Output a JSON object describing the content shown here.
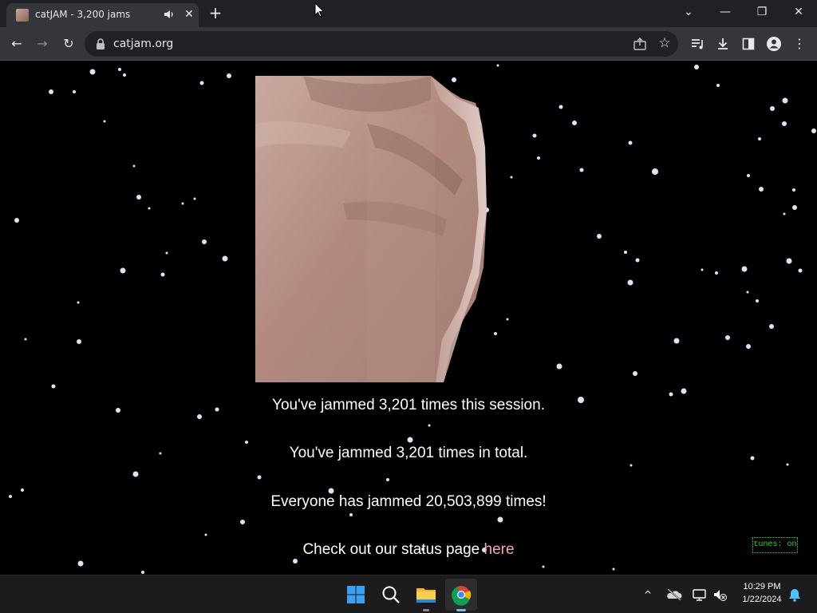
{
  "browser": {
    "tab": {
      "title": "catJAM - 3,200 jams",
      "audio_icon": "speaker-icon",
      "close_label": "✕"
    },
    "new_tab_label": "+",
    "window": {
      "tab_search_label": "⌄",
      "minimize_label": "—",
      "restore_label": "❐",
      "close_label": "✕"
    },
    "toolbar": {
      "back_label": "←",
      "forward_label": "→",
      "reload_label": "↻",
      "url": "catjam.org",
      "star_label": "☆",
      "menu_label": "⋮"
    }
  },
  "page": {
    "session_text": "You've jammed 3,201 times this session.",
    "total_text": "You've jammed 3,201 times in total.",
    "everyone_text": "Everyone has jammed 20,503,899 times!",
    "status_text": "Check out our status page ",
    "status_link_text": "here",
    "tunes_toggle": "tunes: on"
  },
  "taskbar": {
    "tray_chevron_label": "^",
    "time": "10:29 PM",
    "date": "1/22/2024",
    "icons": [
      "windows-start-icon",
      "search-icon",
      "file-explorer-icon",
      "chrome-icon"
    ]
  },
  "colors": {
    "link": "#f4a9b0",
    "tunes_toggle": "#2fd62f",
    "background": "#000000",
    "chrome_frame": "#202124",
    "chrome_toolbar": "#35363a"
  }
}
